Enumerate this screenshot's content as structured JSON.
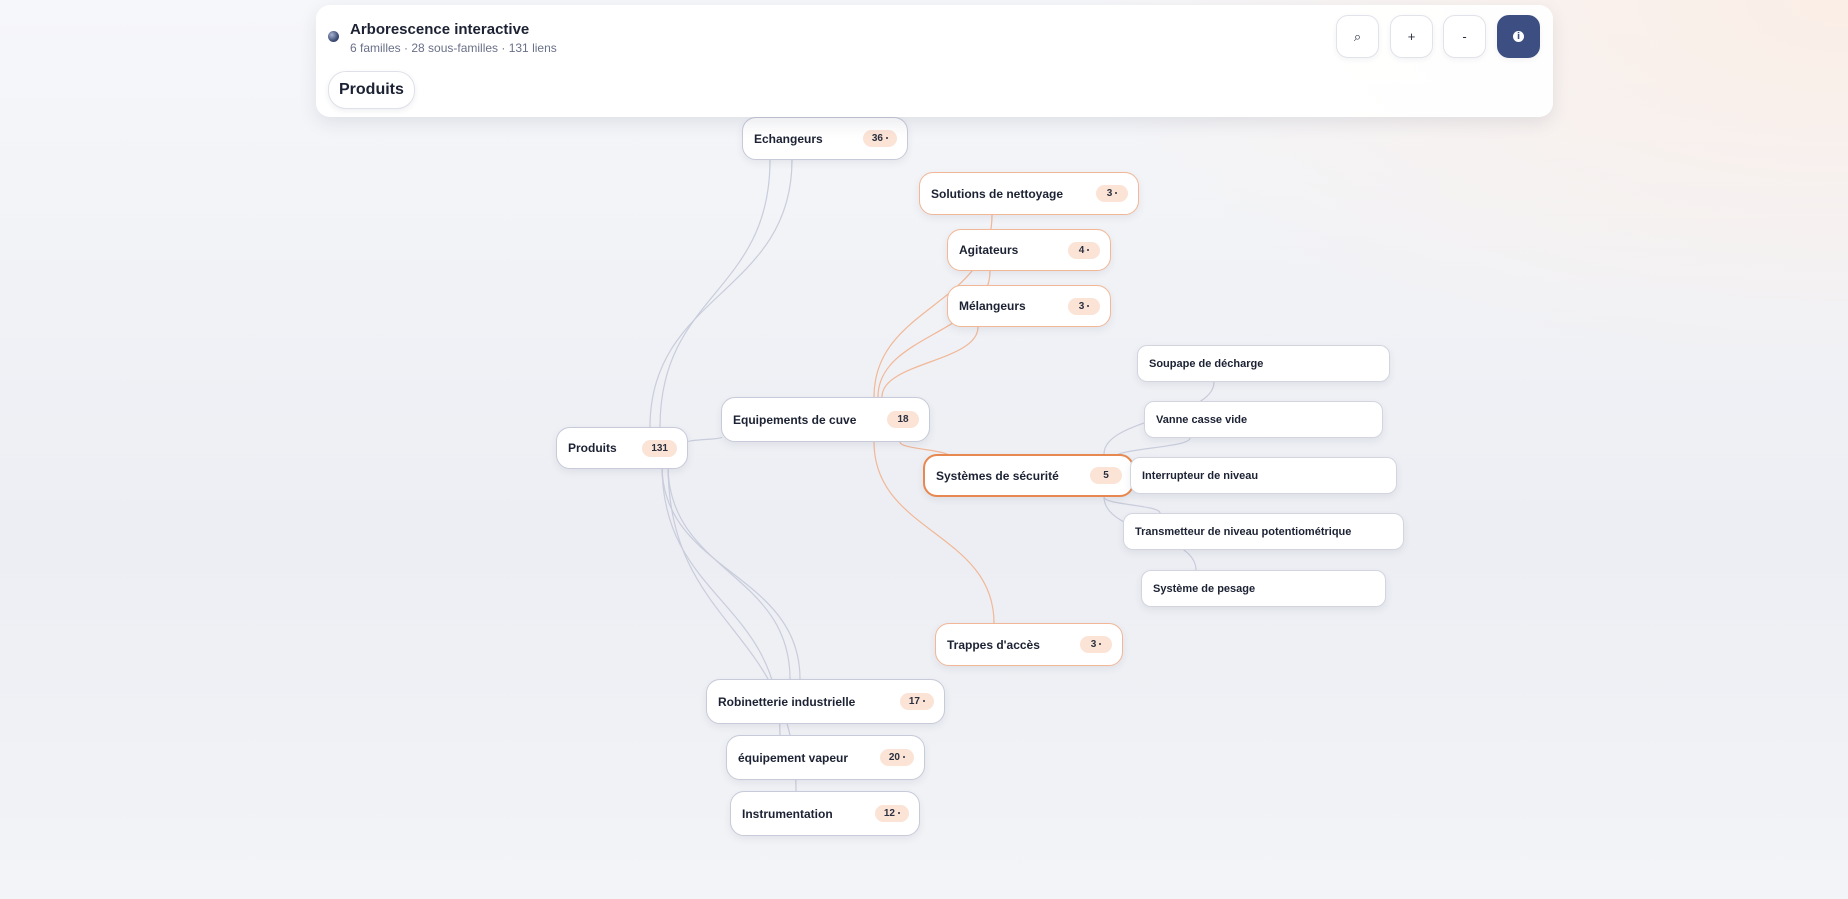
{
  "header": {
    "title": "Arborescence interactive",
    "subtitle": "6 familles · 28 sous-familles · 131 liens",
    "breadcrumb": "Produits",
    "tools": [
      {
        "name": "search-button",
        "icon": "search-icon",
        "glyph": "⌕"
      },
      {
        "name": "zoom-in-button",
        "icon": "plus-icon",
        "glyph": "+"
      },
      {
        "name": "zoom-out-button",
        "icon": "minus-icon",
        "glyph": "-"
      },
      {
        "name": "info-button",
        "icon": "info-icon",
        "glyph": "i"
      }
    ]
  },
  "tree": {
    "root": {
      "label": "Produits",
      "count": "131"
    },
    "families": [
      {
        "label": "Echangeurs",
        "count": "36"
      },
      {
        "label": "Equipements de cuve",
        "count": "18"
      },
      {
        "label": "Robinetterie industrielle",
        "count": "17"
      },
      {
        "label": "équipement vapeur",
        "count": "20"
      },
      {
        "label": "Instrumentation",
        "count": "12"
      }
    ],
    "subfamilies": [
      {
        "label": "Solutions de nettoyage",
        "count": "3"
      },
      {
        "label": "Agitateurs",
        "count": "4"
      },
      {
        "label": "Mélangeurs",
        "count": "3"
      },
      {
        "label": "Systèmes de sécurité",
        "count": "5"
      },
      {
        "label": "Trappes d'accès",
        "count": "3"
      }
    ],
    "leaves": [
      {
        "label": "Soupape de décharge"
      },
      {
        "label": "Vanne casse vide"
      },
      {
        "label": "Interrupteur de niveau"
      },
      {
        "label": "Transmetteur de niveau potentiométrique"
      },
      {
        "label": "Système de pesage"
      }
    ]
  },
  "colors": {
    "accent": "#3d4f82",
    "edge_neutral": "#c9ccdb",
    "edge_orange": "#f1b797",
    "selected_border": "#e6884f",
    "badge_bg": "#fbe3d6"
  }
}
